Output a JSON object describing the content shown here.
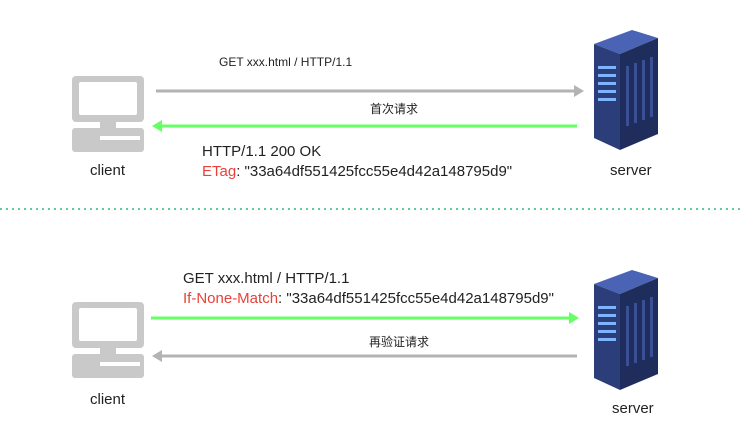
{
  "top": {
    "request_line": "GET xxx.html / HTTP/1.1",
    "caption": "首次请求",
    "status_line": "HTTP/1.1 200 OK",
    "header_name": "ETag",
    "header_sep": ": ",
    "header_value": "\"33a64df551425fcc55e4d42a148795d9\"",
    "client_label": "client",
    "server_label": "server"
  },
  "bottom": {
    "request_line": "GET xxx.html / HTTP/1.1",
    "header_name": "If-None-Match",
    "header_sep": ": ",
    "header_value": "\"33a64df551425fcc55e4d42a148795d9\"",
    "caption": "再验证请求",
    "client_label": "client",
    "server_label": "server"
  },
  "colors": {
    "request_arrow": "#b3b3b3",
    "response_arrow": "#66ff66",
    "header_name": "#e8413a",
    "divider": "#2eb87a",
    "server_body": "#2c3e7a",
    "computer_gray": "#c9c9c9"
  },
  "icons": {
    "client": "desktop-computer-icon",
    "server": "server-rack-icon"
  }
}
